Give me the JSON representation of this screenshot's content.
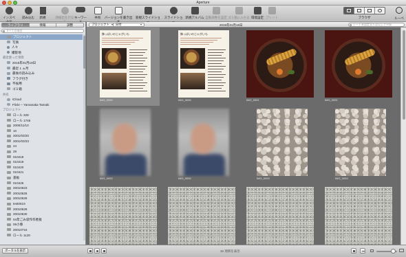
{
  "window": {
    "title": "Aperture"
  },
  "toolbar": {
    "buttons": [
      {
        "label": "インスペクタ",
        "icon": "inspector-icon",
        "enabled": true
      },
      {
        "label": "読み込む",
        "icon": "import-icon",
        "enabled": true
      },
      {
        "label": "新規",
        "icon": "new-plus-icon",
        "enabled": true
      },
      {
        "label": "顔検出を行なる",
        "icon": "faces-icon",
        "enabled": false
      },
      {
        "label": "キーワード",
        "icon": "keyword-icon",
        "enabled": true
      },
      {
        "label": "共有",
        "icon": "share-icon",
        "enabled": true
      },
      {
        "label": "バージョンを書き出す",
        "icon": "export-icon",
        "enabled": true
      },
      {
        "label": "新規スライドショー",
        "icon": "slideshow-icon",
        "enabled": true
      },
      {
        "label": "スライドショー",
        "icon": "play-slideshow-icon",
        "enabled": true
      },
      {
        "label": "新規アルバム",
        "icon": "new-album-icon",
        "enabled": true
      },
      {
        "label": "自動調整を設定",
        "icon": "auto-adjust-icon",
        "enabled": false
      },
      {
        "label": "ゴミ箱に入れる",
        "icon": "trash-icon",
        "enabled": false
      },
      {
        "label": "環境設定",
        "icon": "preferences-icon",
        "enabled": true
      },
      {
        "label": "プリント",
        "icon": "print-icon",
        "enabled": false
      }
    ],
    "view_label": "ブラウザ",
    "search_label": "ルーペ"
  },
  "sidebar": {
    "tabs": [
      "ライブラリ",
      "情報",
      "調整"
    ],
    "active_tab": "ライブラリ",
    "search_placeholder": "すべての項目",
    "rows": [
      {
        "label": "プロジェクト",
        "kind": "item",
        "selected": true,
        "icon": "projects-icon"
      },
      {
        "label": "写真",
        "kind": "item",
        "icon": "photos-icon"
      },
      {
        "label": "人々",
        "kind": "item",
        "icon": "faces-icon"
      },
      {
        "label": "撮影地",
        "kind": "item",
        "icon": "places-icon"
      },
      {
        "label": "最近使った項目",
        "kind": "head"
      },
      {
        "label": "2015年01月19日",
        "kind": "item",
        "icon": "folder-icon"
      },
      {
        "label": "最近 1 ヵ月",
        "kind": "item",
        "icon": "folder-icon"
      },
      {
        "label": "最後の読み込み",
        "kind": "item",
        "icon": "folder-icon"
      },
      {
        "label": "フラグ付き",
        "kind": "item",
        "icon": "flag-icon"
      },
      {
        "label": "不採用",
        "kind": "item",
        "icon": "rejected-icon"
      },
      {
        "label": "ゴミ箱",
        "kind": "item",
        "icon": "trash-icon"
      },
      {
        "label": "共有",
        "kind": "head"
      },
      {
        "label": "iCloud",
        "kind": "item",
        "icon": "icloud-icon"
      },
      {
        "label": "Flickr – Yamanaka Tamaki",
        "kind": "item",
        "icon": "flickr-icon"
      },
      {
        "label": "プロジェクト",
        "kind": "head"
      },
      {
        "label": "ロール 329",
        "kind": "item",
        "icon": "project-icon"
      },
      {
        "label": "ロール 1745",
        "kind": "item",
        "icon": "project-icon"
      },
      {
        "label": "2000/11/10",
        "kind": "item",
        "icon": "project-icon"
      },
      {
        "label": "10",
        "kind": "item",
        "icon": "project-icon"
      },
      {
        "label": "2001/03/20",
        "kind": "item",
        "icon": "project-icon"
      },
      {
        "label": "2001/03/23",
        "kind": "item",
        "icon": "project-icon"
      },
      {
        "label": "24",
        "kind": "item",
        "icon": "project-icon"
      },
      {
        "label": "29",
        "kind": "item",
        "icon": "project-icon"
      },
      {
        "label": "010418",
        "kind": "item",
        "icon": "project-icon"
      },
      {
        "label": "010419",
        "kind": "item",
        "icon": "project-icon"
      },
      {
        "label": "010420",
        "kind": "item",
        "icon": "project-icon"
      },
      {
        "label": "010421",
        "kind": "item",
        "icon": "project-icon"
      },
      {
        "label": "基板",
        "kind": "item",
        "icon": "project-icon"
      },
      {
        "label": "010426",
        "kind": "item",
        "icon": "project-icon"
      },
      {
        "label": "20010623",
        "kind": "item",
        "icon": "project-icon"
      },
      {
        "label": "20010626",
        "kind": "item",
        "icon": "project-icon"
      },
      {
        "label": "20010628",
        "kind": "item",
        "icon": "project-icon"
      },
      {
        "label": "test0619",
        "kind": "item",
        "icon": "project-icon"
      },
      {
        "label": "20010628",
        "kind": "item",
        "icon": "project-icon"
      },
      {
        "label": "20010630",
        "kind": "item",
        "icon": "project-icon"
      },
      {
        "label": "04年ごみ袋作作者板",
        "kind": "item",
        "icon": "project-icon"
      },
      {
        "label": "06小春",
        "kind": "item",
        "icon": "project-icon"
      },
      {
        "label": "20010715",
        "kind": "item",
        "icon": "project-icon"
      },
      {
        "label": "ロール 1120",
        "kind": "item",
        "icon": "project-icon"
      }
    ]
  },
  "browser": {
    "scope_popup": "プロジェクト",
    "sort_popup": "日付",
    "date": "2015年01月19日",
    "search_placeholder": "レート未設定または以上で不採",
    "thumbnails": [
      {
        "name": "IMG_0090",
        "kind": "doc",
        "selected": true,
        "heading": "飾っぱいのじゃがいも"
      },
      {
        "name": "IMG_0090",
        "kind": "doc",
        "selected": false,
        "heading": "飾っぱいのじゃがいも"
      },
      {
        "name": "IMG_0091",
        "kind": "soup",
        "selected": false
      },
      {
        "name": "IMG_0091",
        "kind": "soup",
        "selected": false
      },
      {
        "name": "IMG_0092",
        "kind": "blur",
        "selected": false
      },
      {
        "name": "IMG_0092",
        "kind": "blur",
        "selected": false
      },
      {
        "name": "IMG_0093",
        "kind": "pebble",
        "selected": false
      },
      {
        "name": "IMG_0093",
        "kind": "pebble",
        "selected": false
      },
      {
        "name": "",
        "kind": "gravel",
        "selected": false
      },
      {
        "name": "",
        "kind": "gravel",
        "selected": false
      },
      {
        "name": "",
        "kind": "gravel",
        "selected": false
      },
      {
        "name": "",
        "kind": "gravel",
        "selected": false
      }
    ]
  },
  "bottom": {
    "show_portal": "ポータルを表示",
    "count": "36 項目を表示"
  }
}
